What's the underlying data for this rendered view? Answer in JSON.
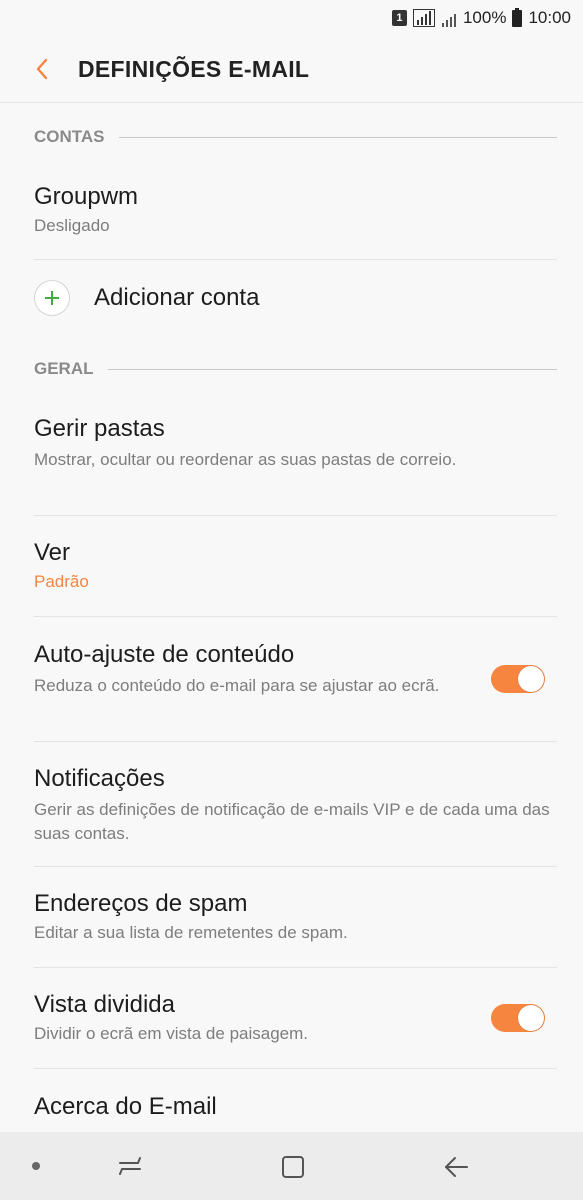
{
  "status_bar": {
    "sim_label": "1",
    "battery_percent": "100%",
    "time": "10:00"
  },
  "header": {
    "title": "DEFINIÇÕES E-MAIL",
    "back_icon": "chevron-left-icon",
    "accent_color": "#f5853f"
  },
  "sections": {
    "accounts": {
      "heading": "CONTAS",
      "account": {
        "name": "Groupwm",
        "status": "Desligado"
      },
      "add_account_label": "Adicionar conta"
    },
    "general": {
      "heading": "GERAL",
      "items": [
        {
          "title": "Gerir pastas",
          "subtitle": "Mostrar, ocultar ou reordenar as suas pastas de correio."
        },
        {
          "title": "Ver",
          "subtitle": "Padrão"
        },
        {
          "title": "Auto-ajuste de conteúdo",
          "subtitle": "Reduza o conteúdo do e-mail para se ajustar ao ecrã.",
          "toggle_on": true
        },
        {
          "title": "Notificações",
          "subtitle": "Gerir as definições de notificação de e-mails VIP e de cada uma das suas contas."
        },
        {
          "title": "Endereços de spam",
          "subtitle": "Editar a sua lista de remetentes de spam."
        },
        {
          "title": "Vista dividida",
          "subtitle": "Dividir o ecrã em vista de paisagem.",
          "toggle_on": true
        },
        {
          "title": "Acerca do E-mail"
        }
      ]
    }
  },
  "nav_bar": {
    "icons": [
      "dot-icon",
      "recents-icon",
      "home-icon",
      "back-arrow-icon"
    ]
  }
}
